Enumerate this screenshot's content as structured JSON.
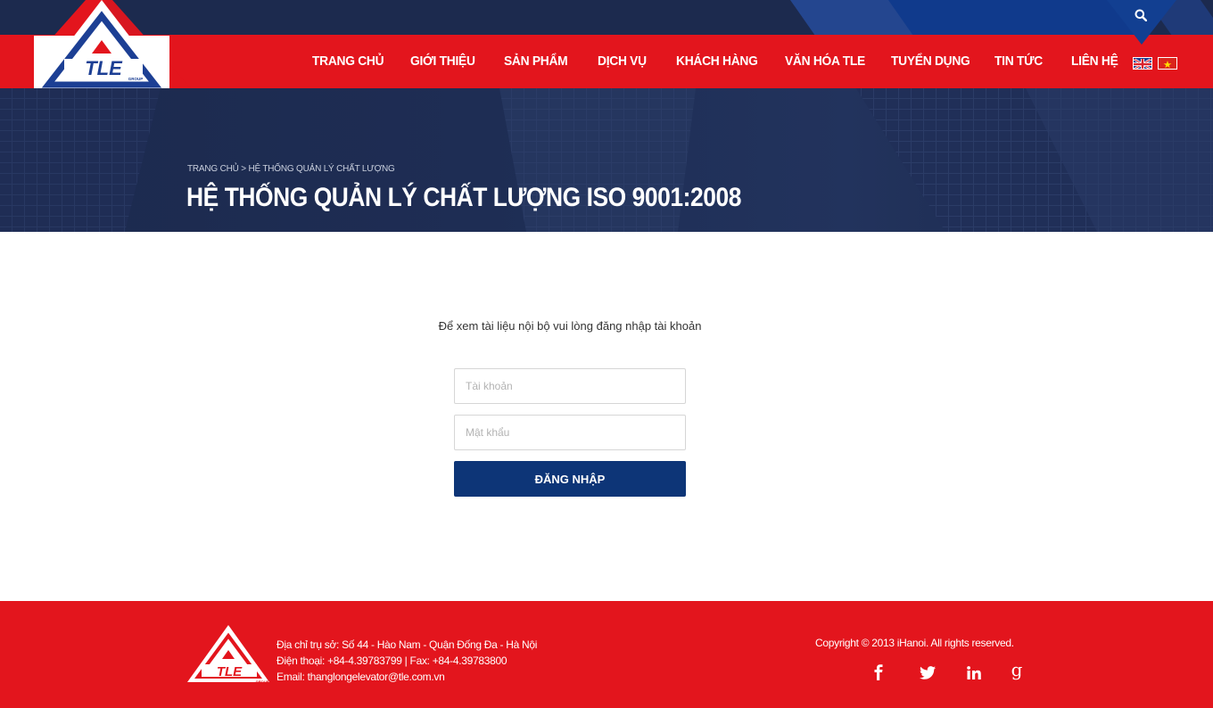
{
  "header": {
    "logo_text": "TLE",
    "logo_sub": "GROUP",
    "nav": [
      {
        "label": "TRANG CHỦ"
      },
      {
        "label": "GIỚI THIỆU"
      },
      {
        "label": "SẢN PHẨM"
      },
      {
        "label": "DỊCH VỤ"
      },
      {
        "label": "KHÁCH HÀNG"
      },
      {
        "label": "VĂN HÓA TLE"
      },
      {
        "label": "TUYỂN DỤNG"
      },
      {
        "label": "TIN TỨC"
      },
      {
        "label": "LIÊN HỆ"
      }
    ],
    "icons": {
      "search": "search-icon",
      "flag_en": "uk-flag-icon",
      "flag_vi": "vietnam-flag-icon"
    }
  },
  "banner": {
    "breadcrumb_home": "TRANG CHỦ",
    "breadcrumb_sep": " > ",
    "breadcrumb_current": "HỆ THỐNG QUẢN LÝ CHẤT LƯỢNG",
    "title": "HỆ THỐNG QUẢN LÝ CHẤT LƯỢNG ISO 9001:2008"
  },
  "login": {
    "notice": "Để xem tài liệu nội bộ vui lòng đăng nhập tài khoản",
    "username_placeholder": "Tài khoản",
    "password_placeholder": "Mật khẩu",
    "submit_label": "ĐĂNG NHẬP"
  },
  "footer": {
    "address": "Địa chỉ trụ sở: Số 44 - Hào Nam - Quận Đống Đa - Hà Nội",
    "phone": "Điện thoại:  +84-4.39783799  |  Fax: +84-4.39783800",
    "email": "Email: thanglongelevator@tle.com.vn",
    "copyright": "Copyright © 2013 iHanoi. All rights reserved.",
    "social": [
      "facebook-icon",
      "twitter-icon",
      "linkedin-icon",
      "google-plus-icon"
    ]
  },
  "colors": {
    "brand_red": "#e3151d",
    "navy": "#1c2a4e",
    "button_blue": "#0d3577"
  }
}
